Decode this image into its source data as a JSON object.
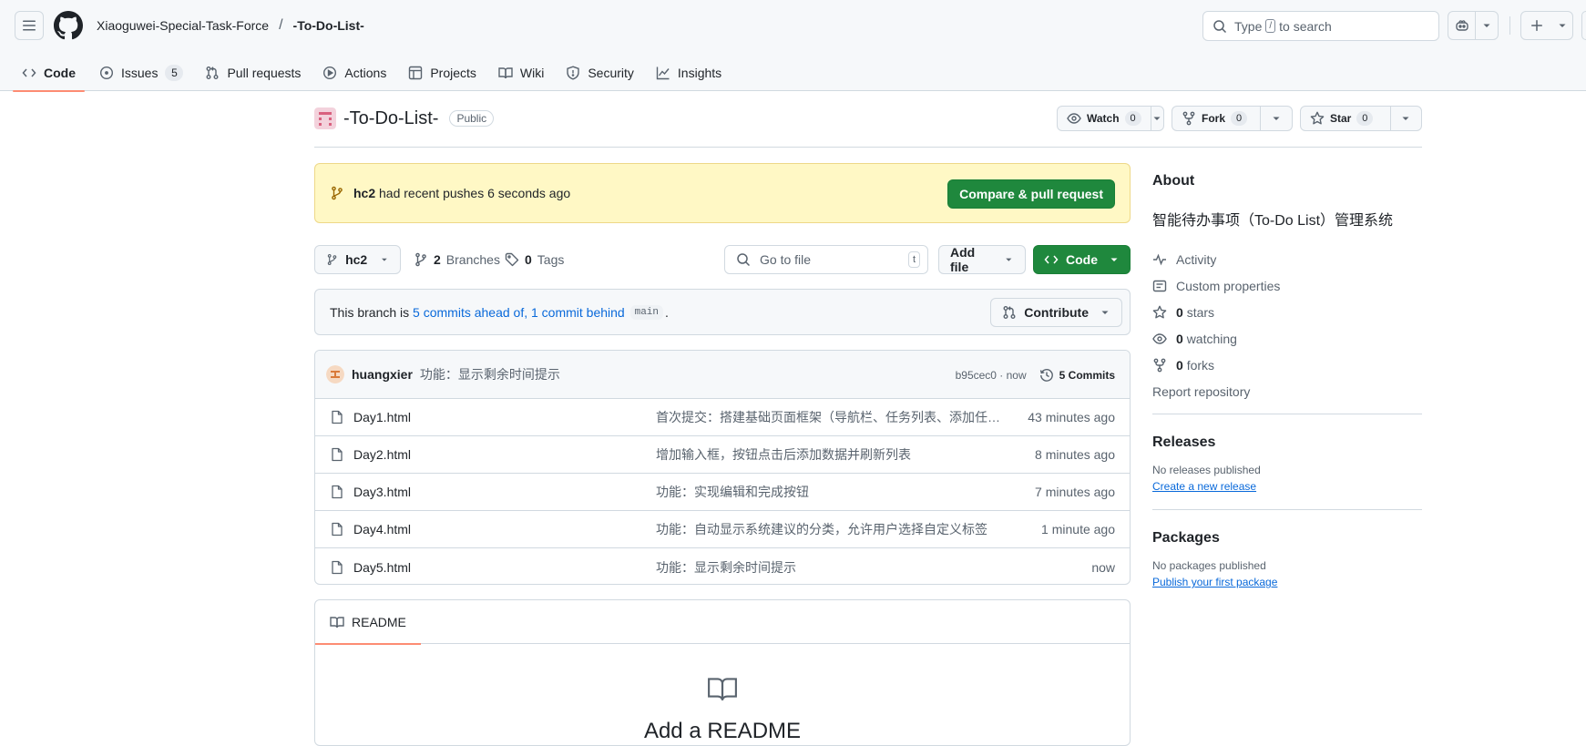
{
  "header": {
    "owner": "Xiaoguwei-Special-Task-Force",
    "separator": "/",
    "repo": "-To-Do-List-",
    "search_prefix": "Type",
    "search_key": "/",
    "search_suffix": "to search"
  },
  "nav": {
    "code": "Code",
    "issues": "Issues",
    "issues_count": "5",
    "pulls": "Pull requests",
    "actions": "Actions",
    "projects": "Projects",
    "wiki": "Wiki",
    "security": "Security",
    "insights": "Insights"
  },
  "repo": {
    "name": "-To-Do-List-",
    "visibility": "Public",
    "watch_label": "Watch",
    "watch_count": "0",
    "fork_label": "Fork",
    "fork_count": "0",
    "star_label": "Star",
    "star_count": "0"
  },
  "push_banner": {
    "branch": "hc2",
    "text": "had recent pushes 6 seconds ago",
    "button": "Compare & pull request"
  },
  "toolbar": {
    "branch": "hc2",
    "branches_count": "2",
    "branches_label": "Branches",
    "tags_count": "0",
    "tags_label": "Tags",
    "goto_placeholder": "Go to file",
    "goto_key": "t",
    "add_file": "Add file",
    "code": "Code"
  },
  "branch_status": {
    "prefix": "This branch is",
    "ahead": "5 commits ahead of,",
    "behind": "1 commit behind",
    "base": "main",
    "suffix": ".",
    "contribute": "Contribute"
  },
  "latest_commit": {
    "author": "huangxier",
    "message": "功能：显示剩余时间提示",
    "sha_time": "b95cec0 · now",
    "commits_label": "5 Commits"
  },
  "files": [
    {
      "name": "Day1.html",
      "message": "首次提交：搭建基础页面框架（导航栏、任务列表、添加任务按钮）",
      "time": "43 minutes ago"
    },
    {
      "name": "Day2.html",
      "message": "增加输入框，按钮点击后添加数据并刷新列表",
      "time": "8 minutes ago"
    },
    {
      "name": "Day3.html",
      "message": "功能：实现编辑和完成按钮",
      "time": "7 minutes ago"
    },
    {
      "name": "Day4.html",
      "message": "功能：自动显示系统建议的分类，允许用户选择自定义标签",
      "time": "1 minute ago"
    },
    {
      "name": "Day5.html",
      "message": "功能：显示剩余时间提示",
      "time": "now"
    }
  ],
  "readme": {
    "tab": "README",
    "heading": "Add a README"
  },
  "sidebar": {
    "about_title": "About",
    "description": "智能待办事项（To-Do List）管理系统",
    "activity": "Activity",
    "custom_properties": "Custom properties",
    "stars_count": "0",
    "stars_label": "stars",
    "watching_count": "0",
    "watching_label": "watching",
    "forks_count": "0",
    "forks_label": "forks",
    "report": "Report repository",
    "releases_title": "Releases",
    "releases_none": "No releases published",
    "releases_link": "Create a new release",
    "packages_title": "Packages",
    "packages_none": "No packages published",
    "packages_link": "Publish your first package"
  },
  "colors": {
    "accent_green": "#1f883d",
    "link_blue": "#0969da",
    "tab_underline": "#fd8c73",
    "banner_bg": "#fff8c5"
  }
}
